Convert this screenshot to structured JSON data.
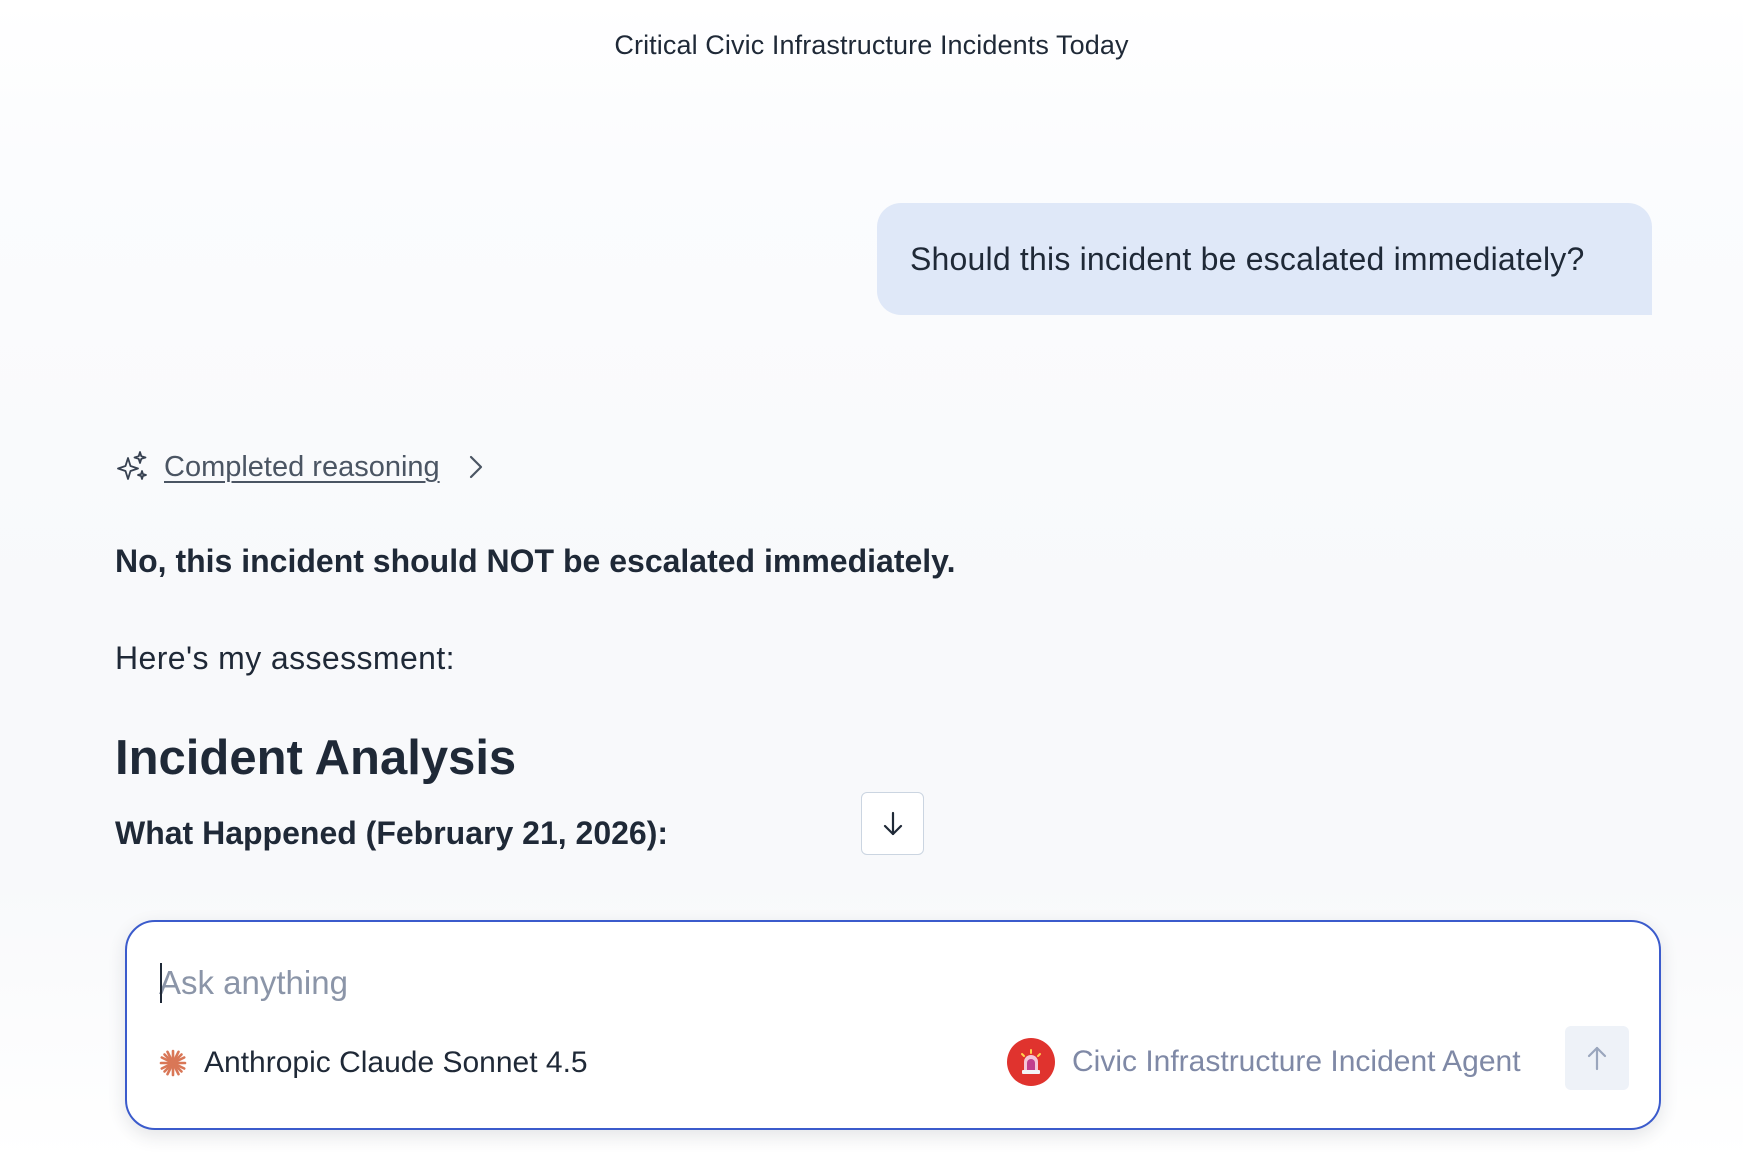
{
  "conversation": {
    "title": "Critical Civic Infrastructure Incidents Today"
  },
  "messages": {
    "user": {
      "text": "Should this incident be escalated immediately?"
    },
    "assistant": {
      "reasoning_label": "Completed reasoning",
      "verdict": "No, this incident should NOT be escalated immediately.",
      "intro": "Here's my assessment:",
      "heading": "Incident Analysis",
      "subheading": "What Happened (February 21, 2026):"
    }
  },
  "composer": {
    "placeholder": "Ask anything",
    "value": "",
    "model_label": "Anthropic Claude Sonnet 4.5",
    "agent_label": "Civic Infrastructure Incident Agent"
  },
  "icons": {
    "sparkle": "sparkle-icon",
    "chevron": "chevron-right-icon",
    "scroll": "arrow-down-icon",
    "model": "anthropic-logo-icon",
    "agent": "siren-icon",
    "send": "arrow-up-icon"
  },
  "colors": {
    "user_bubble": "#dfe8f8",
    "composer_border": "#3b5bcc",
    "model_icon": "#d97757",
    "agent_avatar": "#e0332e",
    "agent_text": "#7f89a6"
  }
}
